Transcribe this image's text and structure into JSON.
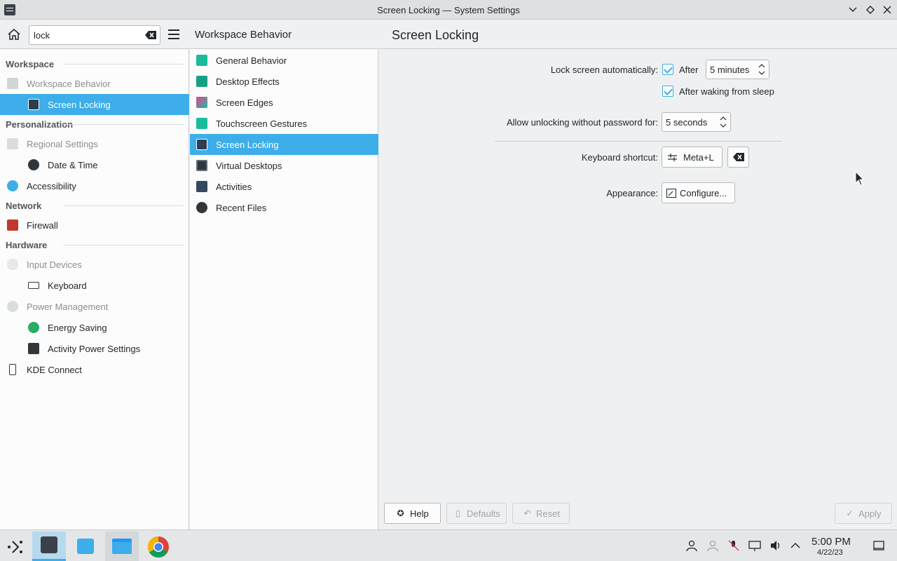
{
  "window": {
    "title": "Screen Locking — System Settings"
  },
  "search": {
    "value": "lock"
  },
  "sidebar": {
    "sections": [
      {
        "title": "Workspace",
        "items": [
          {
            "label": "Workspace Behavior",
            "icon": "workspace-icon",
            "level": 1,
            "dim": true
          },
          {
            "label": "Screen Locking",
            "icon": "lock-icon",
            "level": 2,
            "selected": true
          }
        ]
      },
      {
        "title": "Personalization",
        "items": [
          {
            "label": "Regional Settings",
            "icon": "regional-icon",
            "level": 1,
            "dim": true
          },
          {
            "label": "Date & Time",
            "icon": "clock-icon",
            "level": 2
          },
          {
            "label": "Accessibility",
            "icon": "accessibility-icon",
            "level": 1
          }
        ]
      },
      {
        "title": "Network",
        "items": [
          {
            "label": "Firewall",
            "icon": "firewall-icon",
            "level": 1
          }
        ]
      },
      {
        "title": "Hardware",
        "items": [
          {
            "label": "Input Devices",
            "icon": "mouse-icon",
            "level": 1,
            "dim": true
          },
          {
            "label": "Keyboard",
            "icon": "keyboard-icon",
            "level": 2
          },
          {
            "label": "Power Management",
            "icon": "power-icon",
            "level": 1,
            "dim": true
          },
          {
            "label": "Energy Saving",
            "icon": "energy-icon",
            "level": 2
          },
          {
            "label": "Activity Power Settings",
            "icon": "activity-power-icon",
            "level": 2
          },
          {
            "label": "KDE Connect",
            "icon": "phone-icon",
            "level": 1
          }
        ]
      }
    ]
  },
  "middle": {
    "title": "Workspace Behavior",
    "items": [
      {
        "label": "General Behavior"
      },
      {
        "label": "Desktop Effects"
      },
      {
        "label": "Screen Edges"
      },
      {
        "label": "Touchscreen Gestures"
      },
      {
        "label": "Screen Locking",
        "selected": true
      },
      {
        "label": "Virtual Desktops"
      },
      {
        "label": "Activities"
      },
      {
        "label": "Recent Files"
      }
    ]
  },
  "content": {
    "title": "Screen Locking",
    "lock_auto_label": "Lock screen automatically:",
    "after_label": "After",
    "after_checked": true,
    "after_value": "5 minutes",
    "after_waking_label": "After waking from sleep",
    "after_waking_checked": true,
    "unlock_label": "Allow unlocking without password for:",
    "unlock_value": "5 seconds",
    "shortcut_label": "Keyboard shortcut:",
    "shortcut_value": "Meta+L",
    "appearance_label": "Appearance:",
    "configure_label": "Configure..."
  },
  "footer": {
    "help": "Help",
    "defaults": "Defaults",
    "reset": "Reset",
    "apply": "Apply"
  },
  "taskbar": {
    "time": "5:00 PM",
    "date": "4/22/23"
  },
  "colors": {
    "accent": "#3daee9",
    "background": "#eff0f1",
    "text": "#232629"
  }
}
